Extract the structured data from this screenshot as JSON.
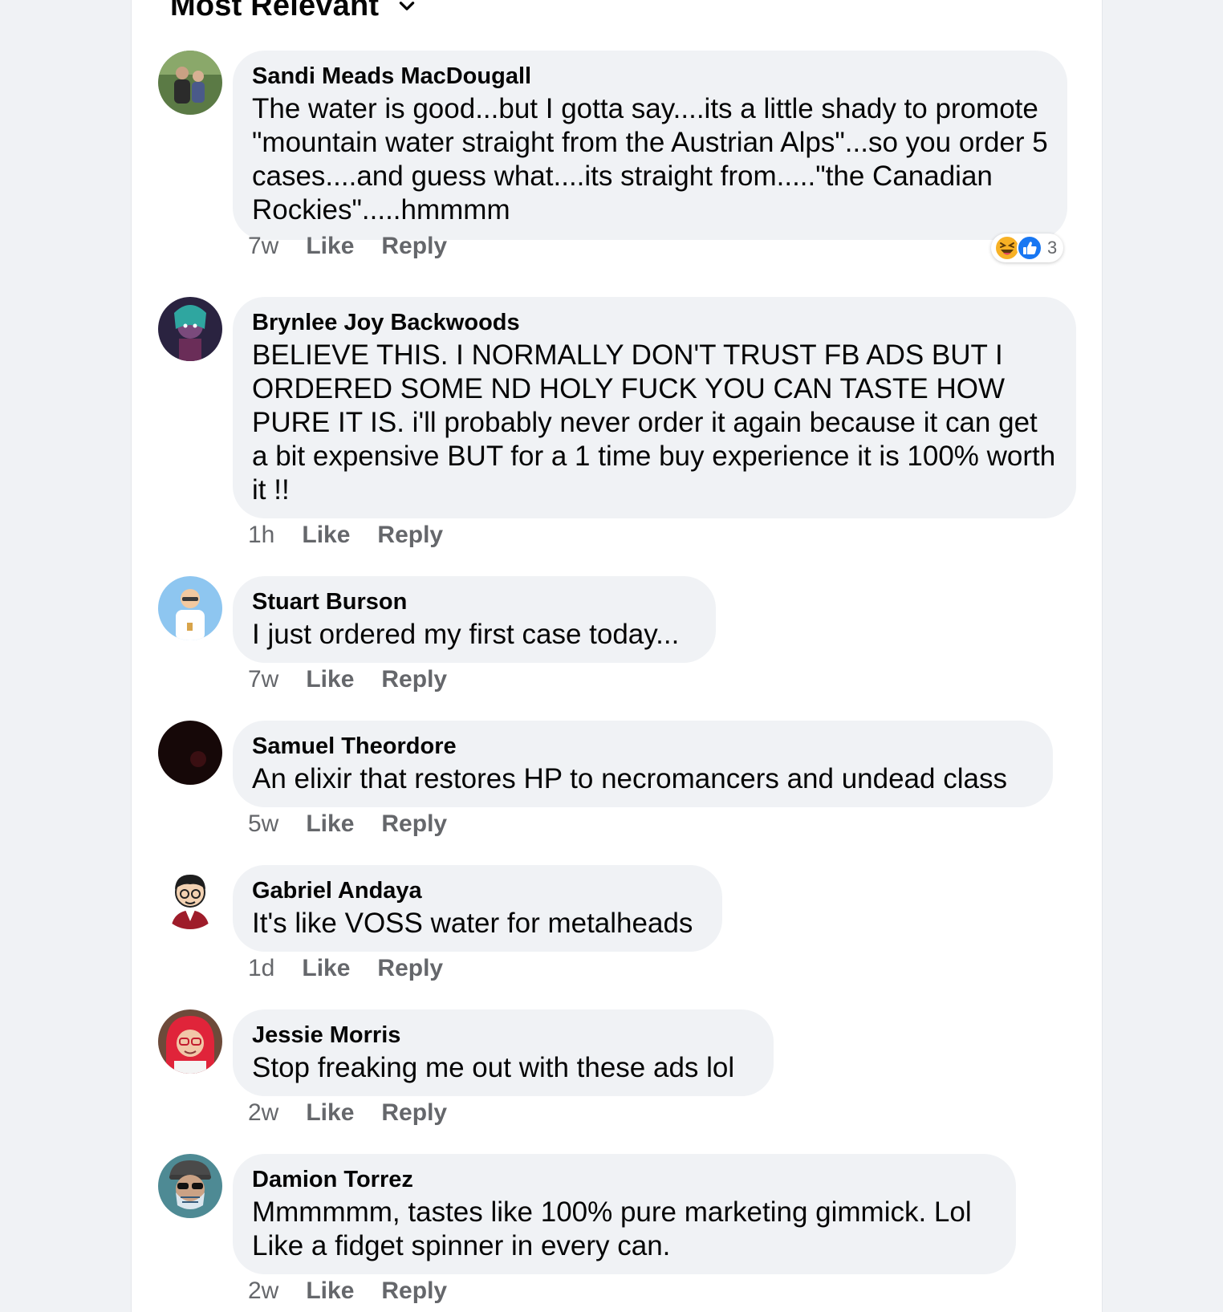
{
  "header": {
    "sort_label": "Most Relevant",
    "sort_icon": "chevron-down-icon"
  },
  "comments": [
    {
      "author": "Sandi Meads MacDougall",
      "text": "The water is good...but I gotta say....its a little shady to promote \"mountain water straight from the Austrian Alps\"...so you order 5 cases....and guess what....its straight from.....\"the Canadian Rockies\".....hmmmm",
      "time": "7w",
      "like": "Like",
      "reply": "Reply",
      "reactions": {
        "icons": [
          "haha-emoji-icon",
          "like-thumb-icon"
        ],
        "count": "3"
      }
    },
    {
      "author": "Brynlee Joy Backwoods",
      "text": "BELIEVE THIS. I NORMALLY DON'T TRUST FB ADS BUT I ORDERED SOME ND HOLY FUCK YOU CAN TASTE HOW PURE IT IS. i'll probably never order it again because it can get a bit expensive BUT for a 1 time buy experience it is 100% worth it !!",
      "time": "1h",
      "like": "Like",
      "reply": "Reply"
    },
    {
      "author": "Stuart Burson",
      "text": "I just ordered my first case today...",
      "time": "7w",
      "like": "Like",
      "reply": "Reply"
    },
    {
      "author": "Samuel Theordore",
      "text": "An elixir that restores HP to necromancers and undead class",
      "time": "5w",
      "like": "Like",
      "reply": "Reply"
    },
    {
      "author": "Gabriel Andaya",
      "text": "It's like VOSS water for metalheads",
      "time": "1d",
      "like": "Like",
      "reply": "Reply"
    },
    {
      "author": "Jessie Morris",
      "text": "Stop freaking me out with these ads lol",
      "time": "2w",
      "like": "Like",
      "reply": "Reply"
    },
    {
      "author": "Damion Torrez",
      "text": "Mmmmmm, tastes like 100% pure marketing gimmick. Lol Like a fidget spinner in every can.",
      "time": "2w",
      "like": "Like",
      "reply": "Reply"
    }
  ],
  "colors": {
    "bubble": "#f0f2f5",
    "meta_text": "#65676b",
    "primary_text": "#050505",
    "like_blue": "#1877f2",
    "haha_yellow": "#f7b125"
  }
}
